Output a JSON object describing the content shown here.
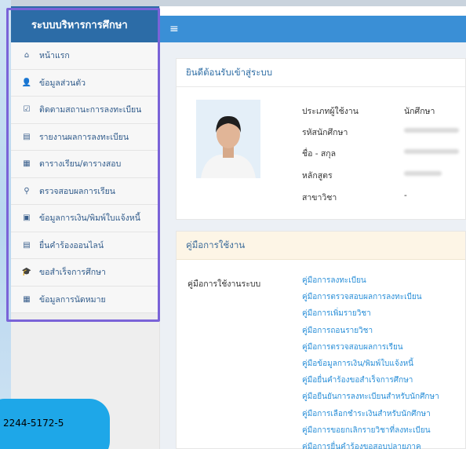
{
  "sidebar": {
    "title": "ระบบบริหารการศึกษา",
    "items": [
      {
        "icon": "home-icon",
        "glyph": "⌂",
        "label": "หน้าแรก"
      },
      {
        "icon": "user-icon",
        "glyph": "👤",
        "label": "ข้อมูลส่วนตัว"
      },
      {
        "icon": "check-square-icon",
        "glyph": "☑",
        "label": "ติดตามสถานะการลงทะเบียน"
      },
      {
        "icon": "document-icon",
        "glyph": "▤",
        "label": "รายงานผลการลงทะเบียน"
      },
      {
        "icon": "table-icon",
        "glyph": "▦",
        "label": "ตารางเรียน/ตารางสอบ"
      },
      {
        "icon": "search-icon",
        "glyph": "⚲",
        "label": "ตรวจสอบผลการเรียน"
      },
      {
        "icon": "money-icon",
        "glyph": "▣",
        "label": "ข้อมูลการเงิน/พิมพ์ใบแจ้งหนี้"
      },
      {
        "icon": "document-icon",
        "glyph": "▤",
        "label": "ยื่นคำร้องออนไลน์"
      },
      {
        "icon": "graduation-cap-icon",
        "glyph": "🎓",
        "label": "ขอสำเร็จการศึกษา"
      },
      {
        "icon": "calendar-icon",
        "glyph": "▦",
        "label": "ข้อมูลการนัดหมาย"
      }
    ]
  },
  "topbar": {
    "menu_glyph": "≡"
  },
  "welcome": {
    "title": "ยินดีต้อนรับเข้าสู่ระบบ",
    "fields": [
      {
        "label": "ประเภทผู้ใช้งาน",
        "value": "นักศึกษา"
      },
      {
        "label": "รหัสนักศึกษา",
        "value": ""
      },
      {
        "label": "ชื่อ - สกุล",
        "value": ""
      },
      {
        "label": "หลักสูตร",
        "value": ""
      },
      {
        "label": "สาขาวิชา",
        "value": "-"
      }
    ]
  },
  "manual": {
    "title": "คู่มือการใช้งาน",
    "label": "คู่มือการใช้งานระบบ",
    "links": [
      "คู่มือการลงทะเบียน",
      "คู่มือการตรวจสอบผลการลงทะเบียน",
      "คู่มือการเพิ่มรายวิชา",
      "คู่มือการถอนรายวิชา",
      "คู่มือการตรวจสอบผลการเรียน",
      "คู่มือข้อมูลการเงิน/พิมพ์ใบแจ้งหนี้",
      "คู่มือยื่นคำร้องขอสำเร็จการศึกษา",
      "คู่มือยืนยันการลงทะเบียนสำหรับนักศึกษา",
      "คู่มือการเลือกชำระเงินสำหรับนักศึกษา",
      "คู่มือการขอยกเลิกรายวิชาที่ลงทะเบียน",
      "คู่มือการยื่นคำร้องขอสอบปลายภาค"
    ]
  },
  "phone": "2244-5172-5"
}
